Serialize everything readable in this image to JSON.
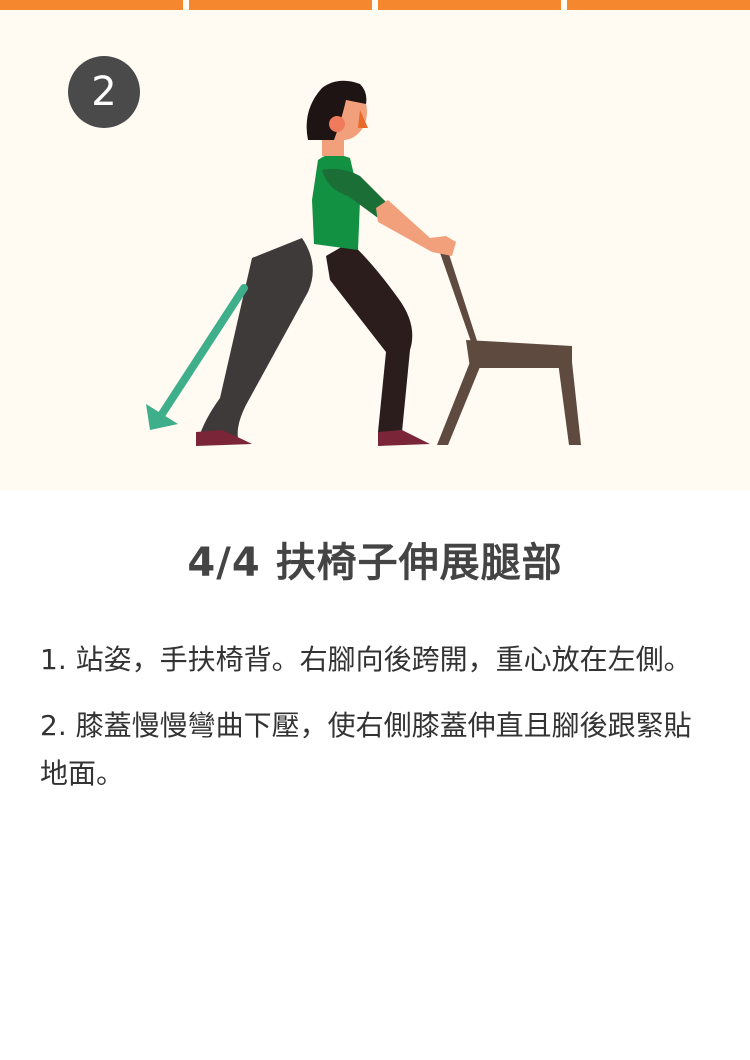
{
  "header": {
    "progress_segments": 4,
    "progress_color": "#f5872f"
  },
  "hero": {
    "step_badge": "2",
    "background": "#fffaf2",
    "illustration_icon": "chair-leg-stretch-illustration",
    "arrow_icon": "diagonal-arrow-down-left-icon",
    "arrow_color": "#3fae8a"
  },
  "exercise": {
    "title": "4/4 扶椅子伸展腿部",
    "steps": [
      "1. 站姿，手扶椅背。右腳向後跨開，重心放在左側。",
      "2. 膝蓋慢慢彎曲下壓，使右側膝蓋伸直且腳後跟緊貼地面。"
    ]
  }
}
